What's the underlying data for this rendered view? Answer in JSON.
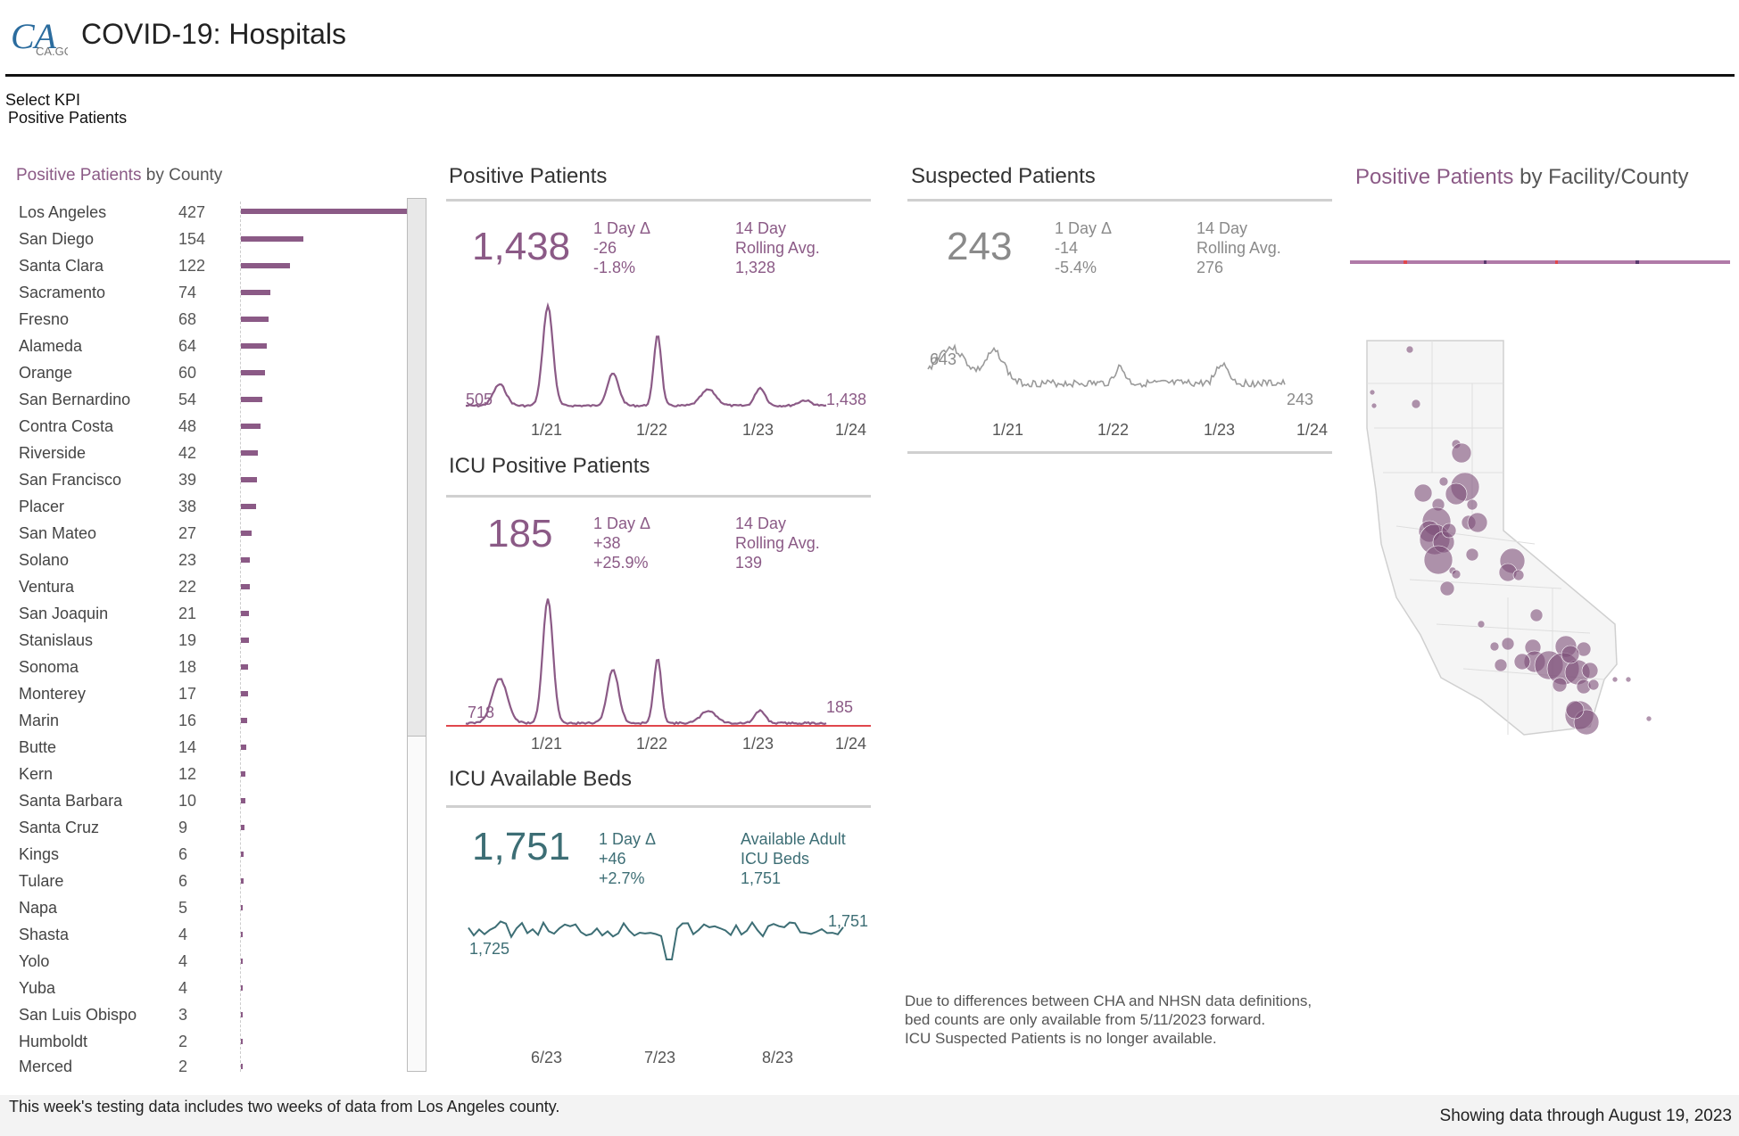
{
  "header": {
    "logo_text": "CA.GOV",
    "title": "COVID-19: Hospitals",
    "kpi_label": "Select KPI",
    "kpi_value": "Positive Patients"
  },
  "colors": {
    "purple": "#8b5a86",
    "teal": "#3d6e75",
    "gray": "#8a8a8a",
    "redline": "#e0474c"
  },
  "county_panel": {
    "title_highlight": "Positive Patients",
    "title_rest": " by County",
    "rows": [
      {
        "name": "Los Angeles",
        "value": 427
      },
      {
        "name": "San Diego",
        "value": 154
      },
      {
        "name": "Santa Clara",
        "value": 122
      },
      {
        "name": "Sacramento",
        "value": 74
      },
      {
        "name": "Fresno",
        "value": 68
      },
      {
        "name": "Alameda",
        "value": 64
      },
      {
        "name": "Orange",
        "value": 60
      },
      {
        "name": "San Bernardino",
        "value": 54
      },
      {
        "name": "Contra Costa",
        "value": 48
      },
      {
        "name": "Riverside",
        "value": 42
      },
      {
        "name": "San Francisco",
        "value": 39
      },
      {
        "name": "Placer",
        "value": 38
      },
      {
        "name": "San Mateo",
        "value": 27
      },
      {
        "name": "Solano",
        "value": 23
      },
      {
        "name": "Ventura",
        "value": 22
      },
      {
        "name": "San Joaquin",
        "value": 21
      },
      {
        "name": "Stanislaus",
        "value": 19
      },
      {
        "name": "Sonoma",
        "value": 18
      },
      {
        "name": "Monterey",
        "value": 17
      },
      {
        "name": "Marin",
        "value": 16
      },
      {
        "name": "Butte",
        "value": 14
      },
      {
        "name": "Kern",
        "value": 12
      },
      {
        "name": "Santa Barbara",
        "value": 10
      },
      {
        "name": "Santa Cruz",
        "value": 9
      },
      {
        "name": "Kings",
        "value": 6
      },
      {
        "name": "Tulare",
        "value": 6
      },
      {
        "name": "Napa",
        "value": 5
      },
      {
        "name": "Shasta",
        "value": 4
      },
      {
        "name": "Yolo",
        "value": 4
      },
      {
        "name": "Yuba",
        "value": 4
      },
      {
        "name": "San Luis Obispo",
        "value": 3
      },
      {
        "name": "Humboldt",
        "value": 2
      },
      {
        "name": "Merced",
        "value": 2
      }
    ]
  },
  "positive": {
    "title": "Positive Patients",
    "big": "1,438",
    "delta_label": "1 Day Δ",
    "delta_abs": "-26",
    "delta_pct": "-1.8%",
    "avg_label1": "14 Day",
    "avg_label2": "Rolling Avg.",
    "avg_value": "1,328",
    "start_label": "505",
    "end_label": "1,438",
    "ticks": [
      "1/21",
      "1/22",
      "1/23",
      "1/24"
    ]
  },
  "icu_positive": {
    "title": "ICU Positive Patients",
    "big": "185",
    "delta_label": "1 Day Δ",
    "delta_abs": "+38",
    "delta_pct": "+25.9%",
    "avg_label1": "14 Day",
    "avg_label2": "Rolling Avg.",
    "avg_value": "139",
    "start_label": "718",
    "end_label": "185",
    "ticks": [
      "1/21",
      "1/22",
      "1/23",
      "1/24"
    ]
  },
  "icu_beds": {
    "title": "ICU Available Beds",
    "big": "1,751",
    "delta_label": "1 Day Δ",
    "delta_abs": "+46",
    "delta_pct": "+2.7%",
    "avail_label1": "Available Adult",
    "avail_label2": "ICU Beds",
    "avail_value": "1,751",
    "start_label": "1,725",
    "end_label": "1,751",
    "ticks": [
      "6/23",
      "7/23",
      "8/23"
    ]
  },
  "suspected": {
    "title": "Suspected Patients",
    "big": "243",
    "delta_label": "1 Day Δ",
    "delta_abs": "-14",
    "delta_pct": "-5.4%",
    "avg_label1": "14 Day",
    "avg_label2": "Rolling Avg.",
    "avg_value": "276",
    "start_label": "643",
    "end_label": "243",
    "ticks": [
      "1/21",
      "1/22",
      "1/23",
      "1/24"
    ]
  },
  "note": {
    "line1": "Due to differences between CHA and NHSN data definitions,",
    "line2": "bed counts are only available from 5/11/2023 forward.",
    "line3": "ICU Suspected Patients is no longer available."
  },
  "map_panel": {
    "title_highlight": "Positive Patients",
    "title_rest": " by Facility/County"
  },
  "footer": {
    "note": "This week's testing data includes two weeks of data from Los Angeles county.",
    "date": "Showing data through August 19, 2023"
  }
}
